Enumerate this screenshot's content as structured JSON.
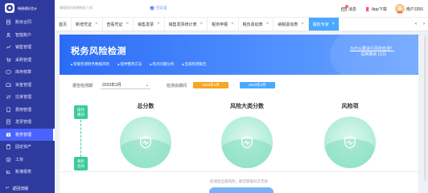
{
  "app": {
    "logo_text_line1": "畅捷通好会计",
    "logo_text_line2": "",
    "brand_color": "#2f3a9e",
    "accent_color": "#4a63ff"
  },
  "sidebar": {
    "items": [
      {
        "label": "账目合同",
        "icon": "ledger-icon"
      },
      {
        "label": "智能账户",
        "icon": "account-icon"
      },
      {
        "label": "销售管理",
        "icon": "sales-icon"
      },
      {
        "label": "采购管理",
        "icon": "cart-icon"
      },
      {
        "label": "库存核算",
        "icon": "box-icon"
      },
      {
        "label": "资金管理",
        "icon": "wallet-icon"
      },
      {
        "label": "往来管理",
        "icon": "exchange-icon"
      },
      {
        "label": "费用管理",
        "icon": "receipt-icon"
      },
      {
        "label": "发票管理",
        "icon": "invoice-icon"
      },
      {
        "label": "税务管理",
        "icon": "tax-icon",
        "active": true
      },
      {
        "label": "固定资产",
        "icon": "building-icon"
      },
      {
        "label": "工资",
        "icon": "salary-icon"
      },
      {
        "label": "账簿报表",
        "icon": "report-icon"
      }
    ],
    "footer_label": "返回旧版"
  },
  "topbar": {
    "search_placeholder": "掌握您的账簿数据/工具",
    "verified_label": "已认证",
    "message_label": "消息",
    "message_count": "9",
    "app_download_label": "App下载",
    "user_name": "南户3355"
  },
  "tabs": [
    {
      "label": "首页",
      "closable": false
    },
    {
      "label": "新增凭证",
      "closable": true
    },
    {
      "label": "查看凭证",
      "closable": true
    },
    {
      "label": "销售发票",
      "closable": true
    },
    {
      "label": "销售发票统计表",
      "closable": true
    },
    {
      "label": "税务申报",
      "closable": true
    },
    {
      "label": "税负逐动表",
      "closable": true
    },
    {
      "label": "纳税逐动表",
      "closable": true
    },
    {
      "label": "税检专家",
      "closable": true,
      "active": true
    }
  ],
  "banner": {
    "title": "税务风险检测",
    "features": [
      "智能检测财务数据风险",
      "提供整改方法",
      "热点问题分析",
      "出具检测报告"
    ],
    "link": "为什么要进行风险检测？",
    "trial": "试用剩余 (1/3)"
  },
  "filters": {
    "period_label": "报告检测期",
    "period_value": "2023年3月",
    "check_period_label": "检测会期间",
    "date_from": "2023年2月",
    "date_to": "2023年3月",
    "date_from_color": "#f5a623",
    "date_to_color": "#4aa8ff"
  },
  "sections": {
    "dimension": "操作\n模块",
    "risk": "税检\n合同"
  },
  "metrics": [
    {
      "title": "总分数",
      "icon": "pulse-shield-icon"
    },
    {
      "title": "风险大类分数",
      "icon": "pulse-shield-icon"
    },
    {
      "title": "风险项",
      "icon": "pulse-shield-icon"
    }
  ],
  "metric_color": "#3ac99b",
  "hint": "检测后全部风险，即可获取对方无忧"
}
